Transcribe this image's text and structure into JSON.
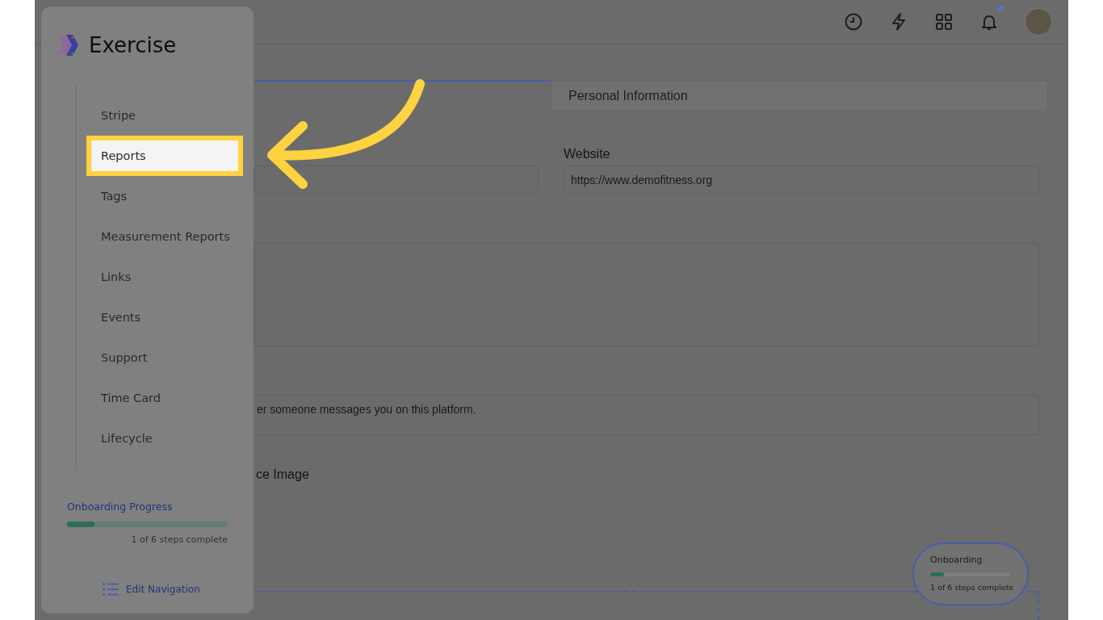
{
  "top_bar": {
    "notifications_unread": true
  },
  "tabs": [
    {
      "selected": true
    },
    {
      "label": "Personal Information",
      "selected": false
    }
  ],
  "form": {
    "website_label": "Website",
    "website_value": "https://www.demofitness.org",
    "message_field_value": "er someone messages you on this platform.",
    "image_label": "ce Image"
  },
  "sidebar": {
    "brand": "Exercise",
    "items": [
      {
        "label": "Stripe",
        "selected": false
      },
      {
        "label": "Reports",
        "selected": true
      },
      {
        "label": "Tags",
        "selected": false
      },
      {
        "label": "Measurement Reports",
        "selected": false
      },
      {
        "label": "Links",
        "selected": false
      },
      {
        "label": "Events",
        "selected": false
      },
      {
        "label": "Support",
        "selected": false
      },
      {
        "label": "Time Card",
        "selected": false
      },
      {
        "label": "Lifecycle",
        "selected": false
      }
    ],
    "progress": {
      "title": "Onboarding Progress",
      "level": 0.17,
      "caption": "1 of 6 steps complete"
    },
    "edit_link": "Edit Navigation"
  },
  "onboarding_widget": {
    "title": "Onboarding",
    "level": 0.17,
    "caption": "1 of 6 steps complete"
  }
}
